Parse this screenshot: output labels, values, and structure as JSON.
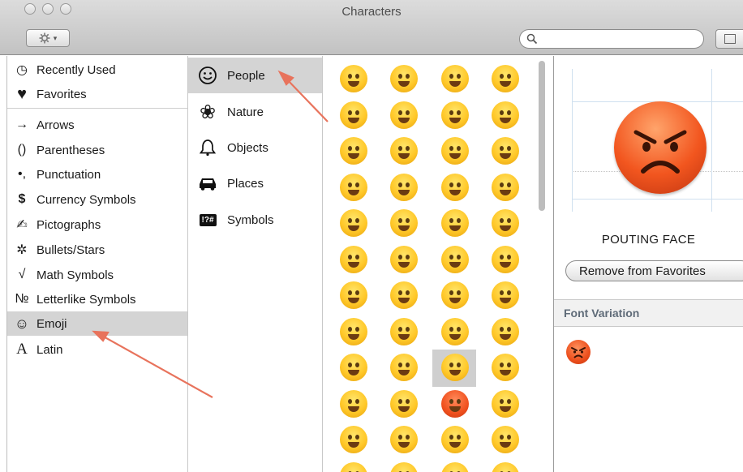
{
  "window": {
    "title": "Characters"
  },
  "toolbar": {
    "gear_icon": "gear-icon",
    "search": {
      "value": "",
      "placeholder": ""
    }
  },
  "sidebar": {
    "items": [
      {
        "label": "Recently Used",
        "icon": "◷"
      },
      {
        "label": "Favorites",
        "icon": "♥"
      },
      {
        "label": "Arrows",
        "icon": "→"
      },
      {
        "label": "Parentheses",
        "icon": "()"
      },
      {
        "label": "Punctuation",
        "icon": "•,"
      },
      {
        "label": "Currency Symbols",
        "icon": "$"
      },
      {
        "label": "Pictographs",
        "icon": "✍"
      },
      {
        "label": "Bullets/Stars",
        "icon": "✲"
      },
      {
        "label": "Math Symbols",
        "icon": "√"
      },
      {
        "label": "Letterlike Symbols",
        "icon": "№"
      },
      {
        "label": "Emoji",
        "icon": "☺"
      },
      {
        "label": "Latin",
        "icon": "A"
      }
    ],
    "selected": "Emoji"
  },
  "categories": {
    "items": [
      {
        "label": "People",
        "icon": "☺"
      },
      {
        "label": "Nature",
        "icon": "❀"
      },
      {
        "label": "Objects",
        "icon": "bell"
      },
      {
        "label": "Places",
        "icon": "car"
      },
      {
        "label": "Symbols",
        "icon": "!?#"
      }
    ],
    "selected": "People"
  },
  "emoji_grid": {
    "rows": 12,
    "columns": 4,
    "selected": {
      "row": 9,
      "column": 3
    }
  },
  "detail": {
    "character_name": "POUTING FACE",
    "favorites_button": "Remove from Favorites",
    "font_variation_header": "Font Variation"
  },
  "accent": {
    "selection": "#d4d4d4",
    "arrow": "#e8735c"
  }
}
